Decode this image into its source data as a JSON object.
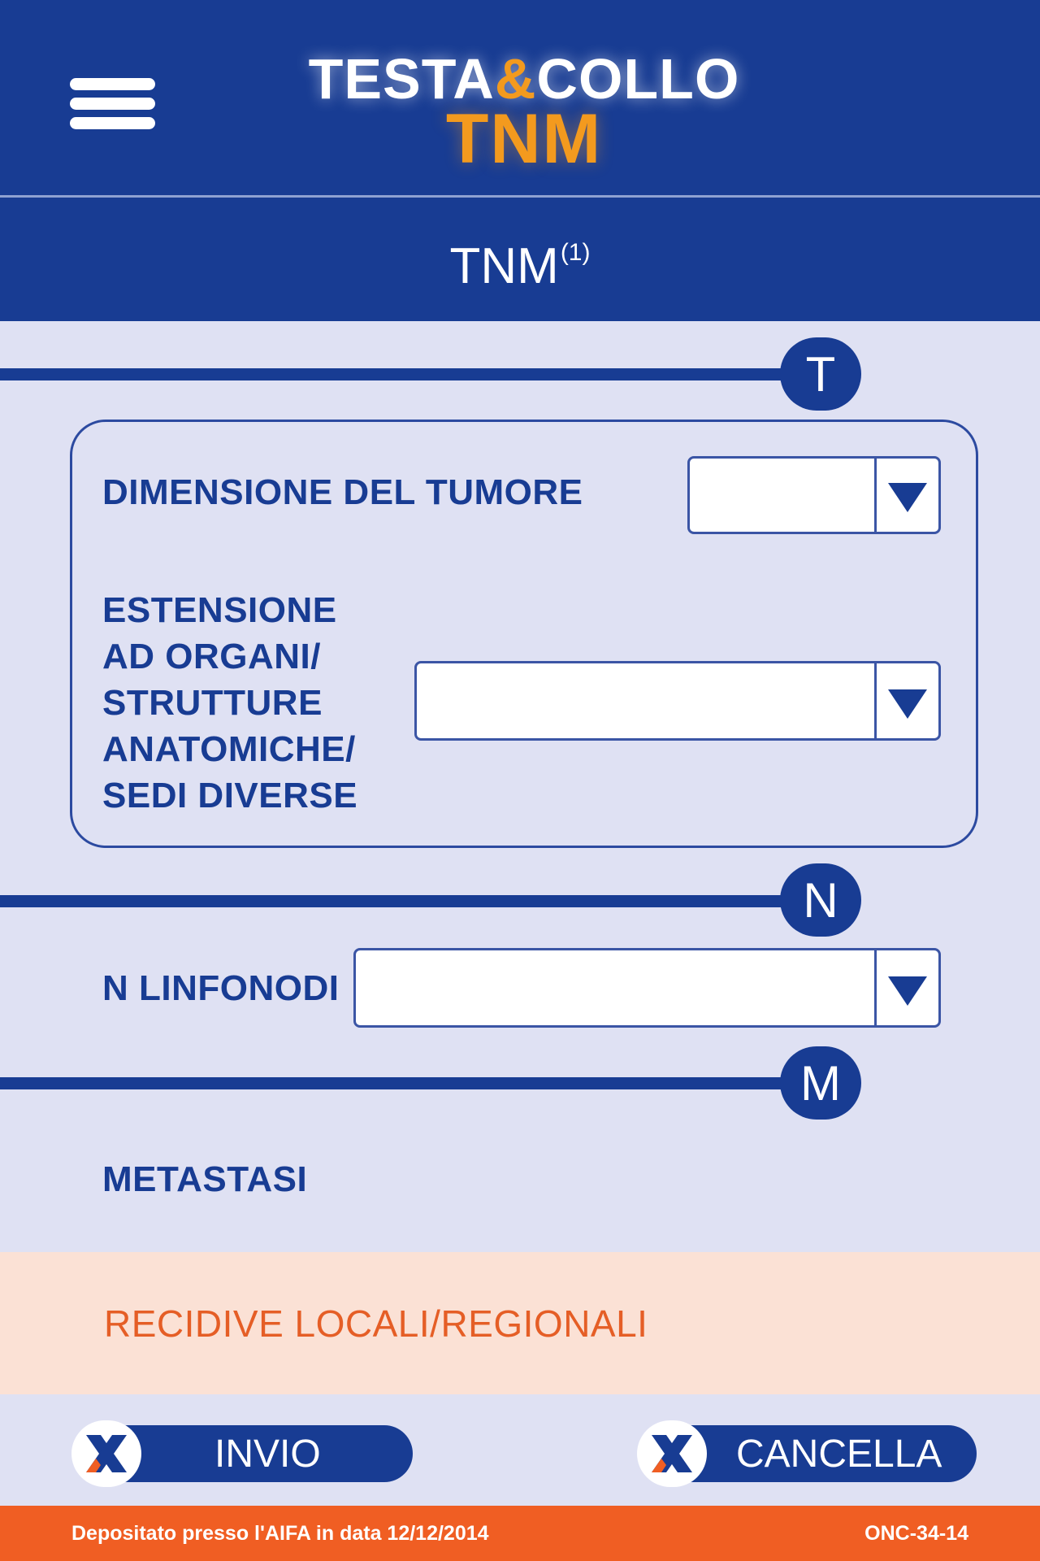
{
  "header": {
    "logo_line1_part1": "TESTA",
    "logo_ampersand": "&",
    "logo_line1_part2": "COLLO",
    "logo_line2": "TNM"
  },
  "title": {
    "text": "TNM",
    "superscript": "(1)"
  },
  "sections": {
    "t_badge": "T",
    "n_badge": "N",
    "m_badge": "M"
  },
  "t_section": {
    "tumor_size_label": "DIMENSIONE DEL TUMORE",
    "tumor_size_value": "",
    "extension_label_lines": [
      "ESTENSIONE",
      "AD ORGANI/",
      "STRUTTURE",
      "ANATOMICHE/",
      "SEDI DIVERSE"
    ],
    "extension_value": ""
  },
  "n_section": {
    "lymph_nodes_label": "N LINFONODI",
    "lymph_nodes_value": ""
  },
  "m_section": {
    "metastasis_label": "METASTASI"
  },
  "recidive": {
    "label": "RECIDIVE LOCALI/REGIONALI"
  },
  "actions": {
    "send_label": "INVIO",
    "cancel_label": "CANCELLA"
  },
  "footer": {
    "deposit_text": "Depositato presso l'AIFA in data 12/12/2014",
    "code": "ONC-34-14"
  },
  "icons": {
    "menu": "hamburger-menu-icon",
    "dropdown": "triangle-down-icon",
    "button_mark": "x-logo-icon"
  },
  "colors": {
    "primary_blue": "#183c93",
    "accent_orange": "#f39a1e",
    "background": "#dfe1f3",
    "recidive_background": "#fbe1d5",
    "recidive_text": "#e55e26",
    "footer": "#f05e23"
  }
}
